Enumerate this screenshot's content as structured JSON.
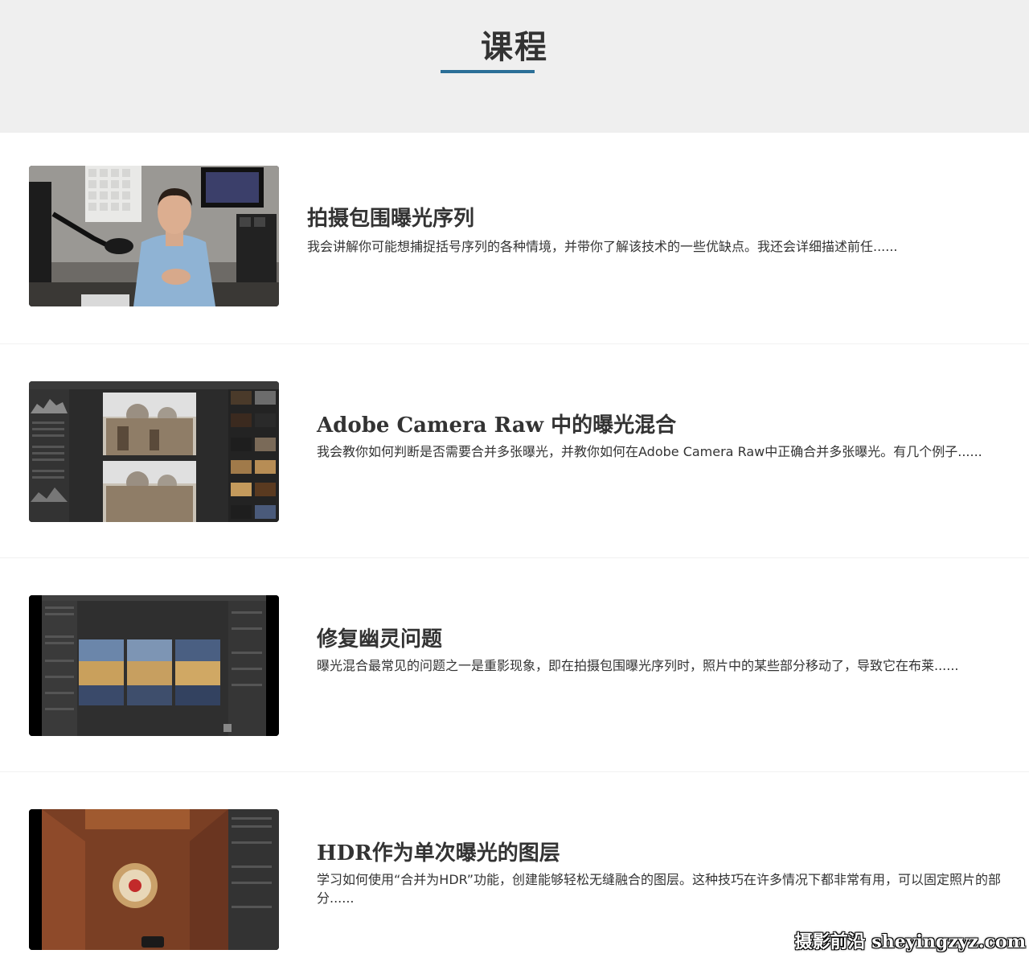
{
  "header": {
    "title": "课程"
  },
  "courses": [
    {
      "title": "拍摄包围曝光序列",
      "description": "我会讲解你可能想捕捉括号序列的各种情境，并带你了解该技术的一些优缺点。我还会详细描述前任......"
    },
    {
      "title": "Adobe Camera Raw 中的曝光混合",
      "description": "我会教你如何判断是否需要合并多张曝光，并教你如何在Adobe Camera Raw中正确合并多张曝光。有几个例子......"
    },
    {
      "title": "修复幽灵问题",
      "description": "曝光混合最常见的问题之一是重影现象，即在拍摄包围曝光序列时，照片中的某些部分移动了，导致它在布莱......"
    },
    {
      "title": "HDR作为单次曝光的图层",
      "description": "学习如何使用“合并为HDR”功能，创建能够轻松无缝融合的图层。这种技巧在许多情况下都非常有用，可以固定照片的部分......"
    }
  ],
  "watermark": "摄影前沿 sheyingzyz.com",
  "colors": {
    "header_bg": "#efefef",
    "accent": "#2b6f97",
    "text": "#333333"
  }
}
